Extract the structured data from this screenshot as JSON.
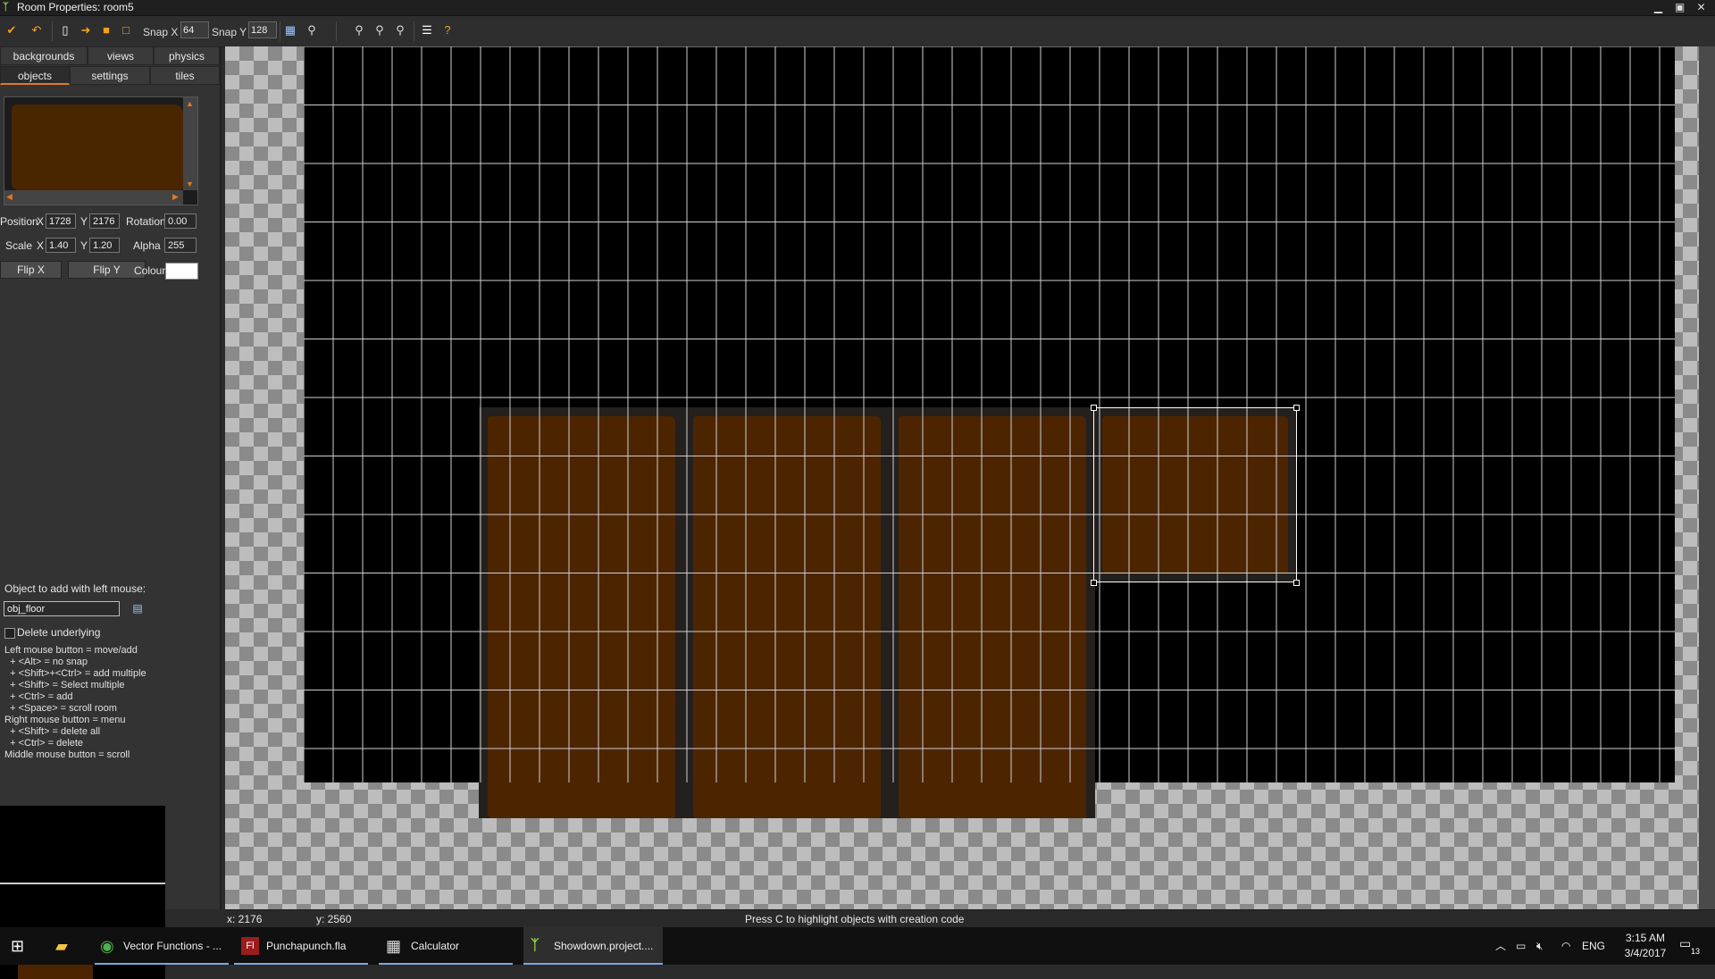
{
  "window": {
    "title": "Room Properties: room5"
  },
  "toolbar": {
    "snap_x_label": "Snap X",
    "snap_x_value": "64",
    "snap_y_label": "Snap Y",
    "snap_y_value": "128"
  },
  "tabs": {
    "row1": [
      "backgrounds",
      "views",
      "physics"
    ],
    "row2": [
      "objects",
      "settings",
      "tiles"
    ],
    "active": "objects"
  },
  "instance": {
    "position_label": "Position",
    "x_label": "X",
    "x_value": "1728",
    "y_label": "Y",
    "y_value": "2176",
    "rotation_label": "Rotation",
    "rotation_value": "0.00",
    "scale_label": "Scale",
    "scale_x_label": "X",
    "scale_x_value": "1.40",
    "scale_y_label": "Y",
    "scale_y_value": "1.20",
    "alpha_label": "Alpha",
    "alpha_value": "255",
    "flip_x_label": "Flip X",
    "flip_y_label": "Flip Y",
    "colour_label": "Colour",
    "colour_value": "#ffffff"
  },
  "object_add": {
    "label": "Object to add with left mouse:",
    "value": "obj_floor",
    "delete_underlying_label": "Delete underlying",
    "delete_underlying_checked": false
  },
  "help_lines": [
    "Left mouse button = move/add",
    "  + <Alt> = no snap",
    "  + <Shift>+<Ctrl> = add multiple",
    "  + <Shift> = Select multiple",
    "  + <Ctrl> = add",
    "  + <Space> = scroll room",
    "Right mouse button = menu",
    "  + <Shift> = delete all",
    "  + <Ctrl> = delete",
    "Middle mouse button = scroll"
  ],
  "status": {
    "x": "x: 2176",
    "y": "y: 2560",
    "message": "Press C to highlight objects with creation code"
  },
  "taskbar": {
    "items": [
      {
        "label": "Vector Functions - ...",
        "icon": "chrome-icon"
      },
      {
        "label": "Punchapunch.fla",
        "icon": "flash-icon"
      },
      {
        "label": "Calculator",
        "icon": "calculator-icon"
      },
      {
        "label": "Showdown.project....",
        "icon": "gamemaker-icon"
      }
    ],
    "language": "ENG",
    "time": "3:15 AM",
    "date": "3/4/2017",
    "notifications": "13"
  },
  "colors": {
    "accent": "#e07a1f",
    "dirt": "#4c2500",
    "room_bg": "#000000"
  }
}
